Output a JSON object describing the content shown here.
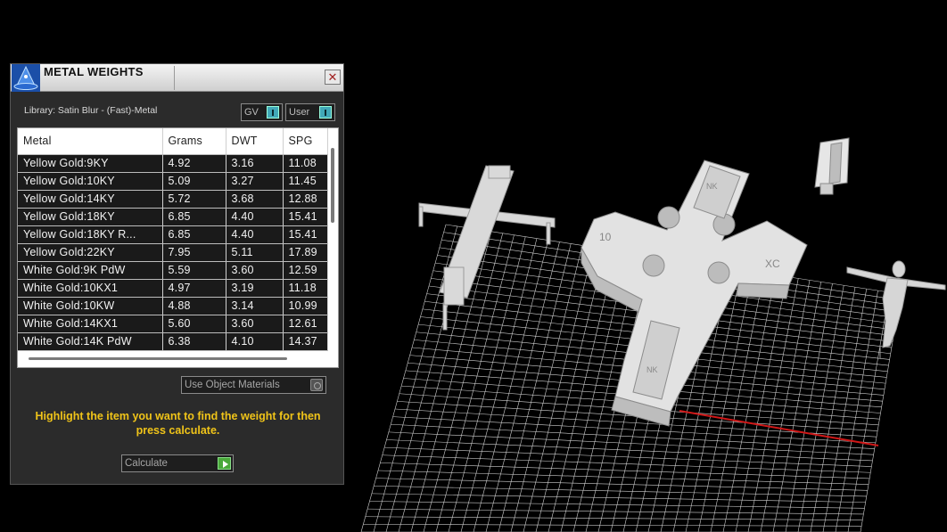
{
  "panel": {
    "title": "METAL WEIGHTS",
    "close_glyph": "✕",
    "library_label": "Library: Satin Blur - (Fast)-Metal",
    "gv_label": "GV",
    "user_label": "User",
    "use_object_materials": "Use Object Materials",
    "instructions": "Highlight the item you want to find the weight for then press calculate.",
    "calculate_label": "Calculate"
  },
  "table": {
    "columns": [
      "Metal",
      "Grams",
      "DWT",
      "SPG"
    ],
    "rows": [
      [
        "Yellow Gold:9KY",
        "4.92",
        "3.16",
        "11.08"
      ],
      [
        "Yellow Gold:10KY",
        "5.09",
        "3.27",
        "11.45"
      ],
      [
        "Yellow Gold:14KY",
        "5.72",
        "3.68",
        "12.88"
      ],
      [
        "Yellow Gold:18KY",
        "6.85",
        "4.40",
        "15.41"
      ],
      [
        "Yellow Gold:18KY R...",
        "6.85",
        "4.40",
        "15.41"
      ],
      [
        "Yellow Gold:22KY",
        "7.95",
        "5.11",
        "17.89"
      ],
      [
        "White Gold:9K PdW",
        "5.59",
        "3.60",
        "12.59"
      ],
      [
        "White Gold:10KX1",
        "4.97",
        "3.19",
        "11.18"
      ],
      [
        "White Gold:10KW",
        "4.88",
        "3.14",
        "10.99"
      ],
      [
        "White Gold:14KX1",
        "5.60",
        "3.60",
        "12.61"
      ],
      [
        "White Gold:14K PdW",
        "6.38",
        "4.10",
        "14.37"
      ]
    ]
  },
  "viewport": {
    "model_labels": [
      "10",
      "XC",
      "NK",
      "NK"
    ]
  },
  "colors": {
    "instruction_text": "#f0c419",
    "indicator_teal": "#41a8b8",
    "play_green": "#4aa83a",
    "grid_line": "#d0d0d0",
    "axis_red": "#d01818"
  },
  "icons": {
    "app": "wizard-hat-icon",
    "close": "close-icon",
    "play": "play-icon"
  }
}
